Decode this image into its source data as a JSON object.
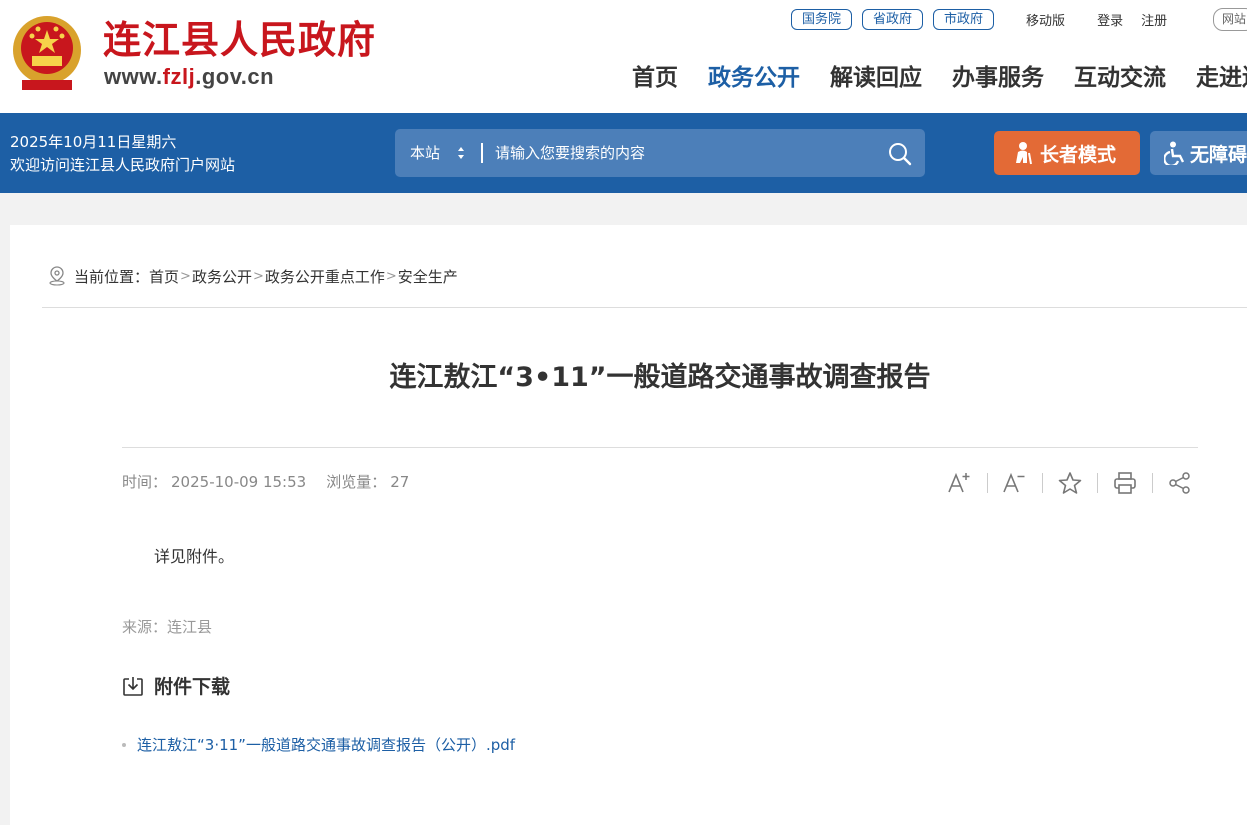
{
  "header": {
    "site_name": "连江县人民政府",
    "domain_prefix": "www.",
    "domain_highlight": "fzlj",
    "domain_suffix": ".gov.cn",
    "top_links": [
      "国务院",
      "省政府",
      "市政府"
    ],
    "mobile": "移动版",
    "login": "登录",
    "register": "注册",
    "site_search_short": "网站",
    "nav": [
      "首页",
      "政务公开",
      "解读回应",
      "办事服务",
      "互动交流",
      "走进连江"
    ],
    "active_nav": "政务公开"
  },
  "bar": {
    "date": "2025年10月11日星期六",
    "welcome": "欢迎访问连江县人民政府门户网站",
    "search_scope": "本站",
    "search_placeholder": "请输入您要搜索的内容",
    "elder_mode": "长者模式",
    "accessibility": "无障碍"
  },
  "breadcrumb": {
    "label": "当前位置：",
    "items": [
      "首页",
      "政务公开",
      "政务公开重点工作",
      "安全生产"
    ],
    "separator": ">"
  },
  "article": {
    "title": "连江敖江“3•11”一般道路交通事故调查报告",
    "time_label": "时间：",
    "time": "2025-10-09 15:53",
    "views_label": "浏览量：",
    "views": "27",
    "body": "详见附件。",
    "source_label": "来源：",
    "source": "连江县"
  },
  "attachments": {
    "heading": "附件下载",
    "items": [
      "连江敖江“3·11”一般道路交通事故调查报告（公开）.pdf"
    ]
  },
  "colors": {
    "brand_red": "#c8161d",
    "brand_blue": "#1d5fa5",
    "elder_orange": "#e36a36"
  }
}
